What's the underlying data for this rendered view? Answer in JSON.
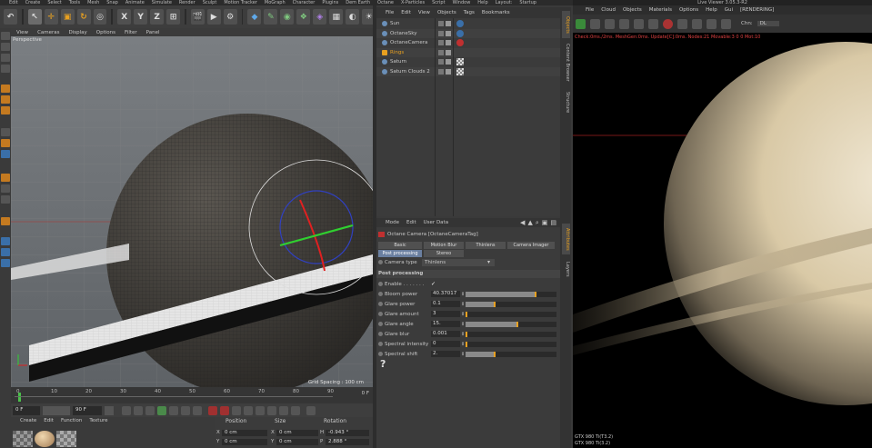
{
  "main_menu": [
    "Edit",
    "Create",
    "Select",
    "Tools",
    "Mesh",
    "Snap",
    "Animate",
    "Simulate",
    "Render",
    "Sculpt",
    "Motion Tracker",
    "MoGraph",
    "Character",
    "Plugins",
    "Dem Earth",
    "Octane",
    "X-Particles",
    "Script",
    "Window",
    "Help",
    "Layout:",
    "Startup"
  ],
  "toolbar": {
    "x": "X",
    "y": "Y",
    "z": "Z"
  },
  "viewport": {
    "menu": [
      "View",
      "Cameras",
      "Display",
      "Options",
      "Filter",
      "Panel"
    ],
    "label": "Perspective",
    "grid_spacing": "Grid Spacing : 100 cm"
  },
  "timeline": {
    "ticks": [
      "0",
      "10",
      "20",
      "30",
      "40",
      "50",
      "60",
      "70",
      "80",
      "90"
    ],
    "current_frame": "0 F",
    "start_field": "0 F",
    "end_field": "90 F",
    "min_field": "90 F"
  },
  "material_panel": {
    "menu": [
      "Create",
      "Edit",
      "Function",
      "Texture"
    ]
  },
  "coord_panel": {
    "headers": [
      "Position",
      "Size",
      "Rotation"
    ],
    "rows": [
      {
        "axis": "X",
        "pos": "0 cm",
        "size": "0 cm",
        "rot_label": "H",
        "rot": "-0.943 °"
      },
      {
        "axis": "Y",
        "pos": "0 cm",
        "size": "0 cm",
        "rot_label": "P",
        "rot": "2.888 °"
      }
    ]
  },
  "object_manager": {
    "menu": [
      "File",
      "Edit",
      "View",
      "Objects",
      "Tags",
      "Bookmarks"
    ],
    "objects": [
      {
        "name": "Sun",
        "color": "#c8c8c8"
      },
      {
        "name": "OctaneSky",
        "color": "#c8c8c8"
      },
      {
        "name": "OctaneCamera",
        "color": "#c8c8c8"
      },
      {
        "name": "Rings",
        "color": "#e8a020"
      },
      {
        "name": "Saturn",
        "color": "#c8c8c8"
      },
      {
        "name": "Saturn Clouds 2",
        "color": "#c8c8c8"
      }
    ]
  },
  "side_tabs": [
    "Objects",
    "Content Browser",
    "Structure",
    "Attributes",
    "Layers"
  ],
  "attribute_manager": {
    "menu": [
      "Mode",
      "Edit",
      "User Data"
    ],
    "title": "Octane Camera [OctaneCameraTag]",
    "tabs_row1": [
      "Basic",
      "Motion Blur",
      "Thinlens",
      "Camera Imager"
    ],
    "tabs_row2": [
      "Post processing",
      "Stereo"
    ],
    "camera_type_label": "Camera type",
    "camera_type_value": "Thinlens",
    "section": "Post processing",
    "enable_label": "Enable . . . . . . .",
    "enable_value": "✓",
    "params": [
      {
        "label": "Bloom power",
        "value": "40.37017",
        "fill": 0.78
      },
      {
        "label": "Glare power",
        "value": "0.1",
        "fill": 0.32
      },
      {
        "label": "Glare amount",
        "value": "3",
        "fill": 0.0
      },
      {
        "label": "Glare angle",
        "value": "15.",
        "fill": 0.57
      },
      {
        "label": "Glare blur",
        "value": "0.001",
        "fill": 0.0
      },
      {
        "label": "Spectral intensity",
        "value": "0",
        "fill": 0.0
      },
      {
        "label": "Spectral shift",
        "value": "2.",
        "fill": 0.32
      }
    ],
    "help_icon": "?"
  },
  "live_viewer": {
    "title": "Live Viewer 3.05.3-R2",
    "menu": [
      "File",
      "Cloud",
      "Objects",
      "Materials",
      "Options",
      "Help",
      "Gui",
      "[RENDERING]"
    ],
    "channel_label": "Chn:",
    "channel_value": "DL",
    "status": "Check:0ms./2ms. MeshGen:0ms. Update[C]:0ms. Nodes:21 Movable:3  0 0 Mot:10",
    "gpu": [
      "GTX 980 Ti(T3.2)",
      "GTX 980 Ti(3.2)"
    ]
  },
  "colors": {
    "accent": "#e8a020",
    "selected_tab": "#6a7fa0",
    "status": "#e04040"
  }
}
